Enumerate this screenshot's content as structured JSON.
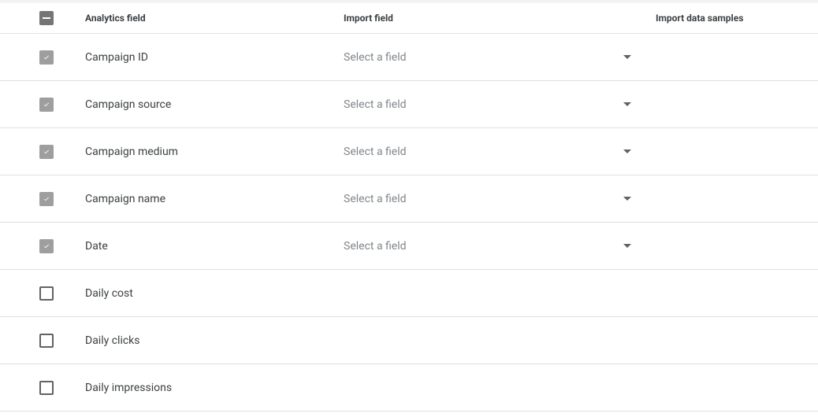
{
  "headers": {
    "analytics": "Analytics field",
    "import": "Import field",
    "samples": "Import data samples"
  },
  "select_placeholder": "Select a field",
  "rows": [
    {
      "label": "Campaign ID",
      "checked": true,
      "hasSelect": true
    },
    {
      "label": "Campaign source",
      "checked": true,
      "hasSelect": true
    },
    {
      "label": "Campaign medium",
      "checked": true,
      "hasSelect": true
    },
    {
      "label": "Campaign name",
      "checked": true,
      "hasSelect": true
    },
    {
      "label": "Date",
      "checked": true,
      "hasSelect": true
    },
    {
      "label": "Daily cost",
      "checked": false,
      "hasSelect": false
    },
    {
      "label": "Daily clicks",
      "checked": false,
      "hasSelect": false
    },
    {
      "label": "Daily impressions",
      "checked": false,
      "hasSelect": false
    }
  ]
}
